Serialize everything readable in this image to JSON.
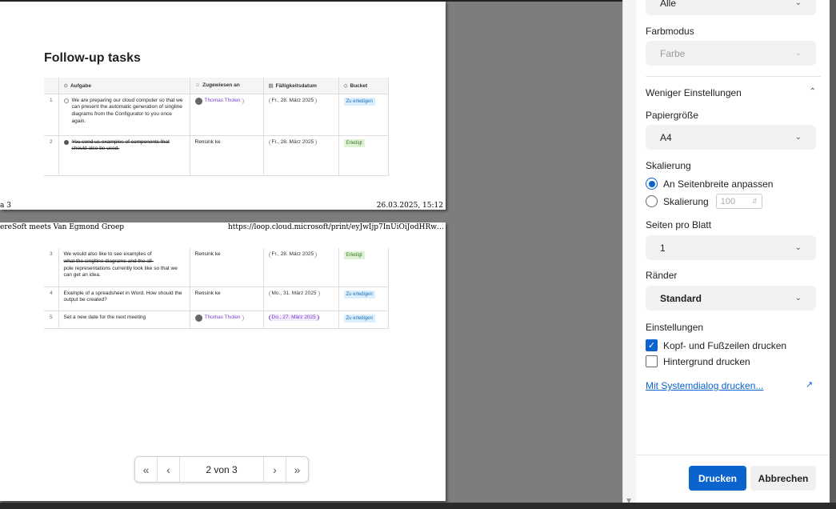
{
  "preview": {
    "page1": {
      "doc_title": "Follow-up tasks",
      "footer_left": "a 3",
      "footer_right": "26.03.2025, 15:12"
    },
    "page2": {
      "header_left": "ereSoft meets Van Egmond Groep",
      "header_right": "https://loop.cloud.microsoft/print/eyJwIjp7InUiOiJodHRwczovL2Ft..."
    },
    "columns": [
      {
        "icon": "⊙",
        "label": "Aufgabe"
      },
      {
        "icon": "☺",
        "label": "Zugewiesen an"
      },
      {
        "icon": "▤",
        "label": "Fälligkeitsdatum"
      },
      {
        "icon": "◇",
        "label": "Bucket"
      }
    ],
    "rows_page1": [
      {
        "num": "1",
        "task": "We are preparing our cloud computer so that we can present the automatic generation of singline diagrams from the Configurator to you once again.",
        "done": false,
        "assignee": "Thomas Tholen",
        "date": "Fr., 28. März 2025",
        "bucket": "Zu erledigen"
      },
      {
        "num": "2",
        "task": "You send us examples of components that should also be used.",
        "done": true,
        "assignee": "Rensink ke",
        "date": "Fr., 28. März 2025",
        "bucket": "Erledigt"
      }
    ],
    "rows_page2": [
      {
        "num": "3",
        "task_plain": "We would also like to see examples of",
        "task_strike": "what the singlline diagrams and the all-",
        "task_rest": "pole representations currently look like so that we can get an idea.",
        "assignee": "Rensink ke",
        "date": "Fr., 28. März 2025",
        "bucket": "Erledigt"
      },
      {
        "num": "4",
        "task": "Example of a spreadsheet in Word. How should the output be created?",
        "assignee": "Rensink ke",
        "date": "Mo., 31. März 2025",
        "bucket": "Zu erledigen"
      },
      {
        "num": "5",
        "task": "Set a new date for the next meeting",
        "assignee": "Thomas Tholen",
        "date": "Do., 27. März 2025",
        "bucket": "Zu erledigen"
      }
    ],
    "pager": {
      "first": "«",
      "prev": "‹",
      "status": "2 von 3",
      "next": "›",
      "last": "»"
    }
  },
  "settings": {
    "pages_select_value": "Alle",
    "color_mode": {
      "label": "Farbmodus",
      "value": "Farbe"
    },
    "less_settings": "Weniger Einstellungen",
    "paper_size": {
      "label": "Papiergröße",
      "value": "A4"
    },
    "scaling": {
      "label": "Skalierung",
      "option_fit": "An Seitenbreite anpassen",
      "option_scale": "Skalierung",
      "scale_value": "100"
    },
    "pages_per_sheet": {
      "label": "Seiten pro Blatt",
      "value": "1"
    },
    "margins": {
      "label": "Ränder",
      "value": "Standard"
    },
    "options": {
      "label": "Einstellungen",
      "headers_footers": "Kopf- und Fußzeilen drucken",
      "background": "Hintergrund drucken"
    },
    "system_dialog_link": "Mit Systemdialog drucken...",
    "print_button": "Drucken",
    "cancel_button": "Abbrechen"
  },
  "colors": {
    "accent": "#0b63ce",
    "preview_bg": "#7d7d7d"
  }
}
